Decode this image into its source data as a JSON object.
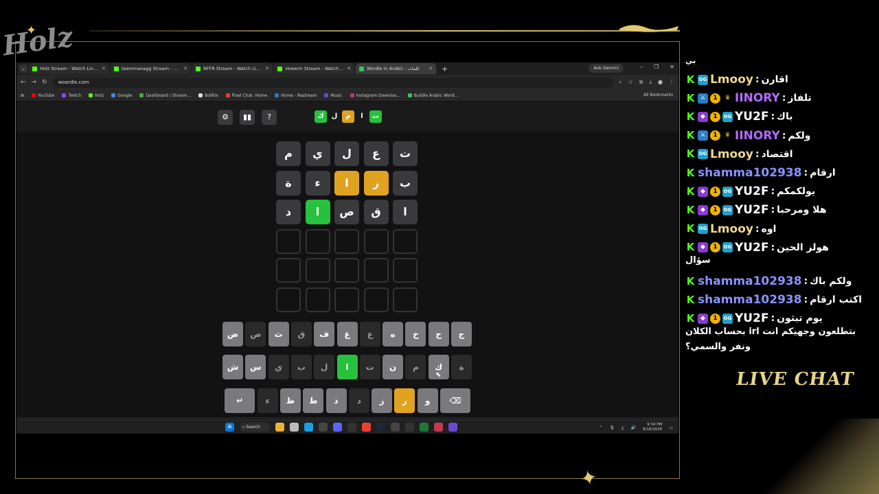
{
  "overlay": {
    "logo_text": "Holz",
    "live_chat_label": "LIVE CHAT"
  },
  "browser": {
    "tabs": [
      {
        "title": "Holz Stream - Watch Live on Ki",
        "active": false
      },
      {
        "title": "teammanagg Stream - Kick Da",
        "active": false
      },
      {
        "title": "NFFR Stream - Watch Live on K",
        "active": false
      },
      {
        "title": "xkwerm Stream - Watch Live o",
        "active": false
      },
      {
        "title": "Wordle in Arabic - كلمات",
        "active": true
      }
    ],
    "ask_gemini": "Ask Gemini",
    "url": "woardle.com",
    "bookmarks": [
      "YouTube",
      "Twitch",
      "Holz",
      "Google",
      "Dashboard / Stream...",
      "BotRix",
      "Pixel Chat: Home",
      "Home - Restream",
      "Music",
      "Instagram Downloa...",
      "Buildle Arabic Word..."
    ],
    "all_bookmarks": "All Bookmarks"
  },
  "game": {
    "logo_tiles": [
      {
        "ch": "ك",
        "state": "correct"
      },
      {
        "ch": "ل",
        "state": "plain"
      },
      {
        "ch": "م",
        "state": "present"
      },
      {
        "ch": "ا",
        "state": "plain"
      },
      {
        "ch": "ت",
        "state": "correct"
      }
    ],
    "rows": [
      [
        {
          "ch": "ت",
          "s": "a"
        },
        {
          "ch": "ع",
          "s": "a"
        },
        {
          "ch": "ل",
          "s": "a"
        },
        {
          "ch": "ي",
          "s": "a"
        },
        {
          "ch": "م",
          "s": "a"
        }
      ],
      [
        {
          "ch": "ب",
          "s": "a"
        },
        {
          "ch": "ر",
          "s": "p"
        },
        {
          "ch": "ا",
          "s": "p"
        },
        {
          "ch": "ء",
          "s": "a"
        },
        {
          "ch": "ة",
          "s": "a"
        }
      ],
      [
        {
          "ch": "ا",
          "s": "a"
        },
        {
          "ch": "ق",
          "s": "a"
        },
        {
          "ch": "ص",
          "s": "a"
        },
        {
          "ch": "ا",
          "s": "c"
        },
        {
          "ch": "د",
          "s": "a"
        }
      ],
      [
        {
          "ch": "",
          "s": "e"
        },
        {
          "ch": "",
          "s": "e"
        },
        {
          "ch": "",
          "s": "e"
        },
        {
          "ch": "",
          "s": "e"
        },
        {
          "ch": "",
          "s": "e"
        }
      ],
      [
        {
          "ch": "",
          "s": "e"
        },
        {
          "ch": "",
          "s": "e"
        },
        {
          "ch": "",
          "s": "e"
        },
        {
          "ch": "",
          "s": "e"
        },
        {
          "ch": "",
          "s": "e"
        }
      ],
      [
        {
          "ch": "",
          "s": "e"
        },
        {
          "ch": "",
          "s": "e"
        },
        {
          "ch": "",
          "s": "e"
        },
        {
          "ch": "",
          "s": "e"
        },
        {
          "ch": "",
          "s": "e"
        }
      ]
    ],
    "keyboard": [
      [
        {
          "k": "ج",
          "s": "n"
        },
        {
          "k": "ح",
          "s": "n"
        },
        {
          "k": "خ",
          "s": "n"
        },
        {
          "k": "ه",
          "s": "n"
        },
        {
          "k": "ع",
          "s": "d"
        },
        {
          "k": "غ",
          "s": "n"
        },
        {
          "k": "ف",
          "s": "n"
        },
        {
          "k": "ق",
          "s": "d"
        },
        {
          "k": "ث",
          "s": "n"
        },
        {
          "k": "ص",
          "s": "d"
        },
        {
          "k": "ض",
          "s": "n"
        }
      ],
      [
        {
          "k": "ة",
          "s": "d"
        },
        {
          "k": "ك",
          "s": "n"
        },
        {
          "k": "م",
          "s": "d"
        },
        {
          "k": "ن",
          "s": "n"
        },
        {
          "k": "ت",
          "s": "d"
        },
        {
          "k": "ا",
          "s": "c"
        },
        {
          "k": "ل",
          "s": "d"
        },
        {
          "k": "ب",
          "s": "d"
        },
        {
          "k": "ي",
          "s": "d"
        },
        {
          "k": "س",
          "s": "n"
        },
        {
          "k": "ش",
          "s": "n"
        }
      ],
      [
        {
          "k": "⌫",
          "s": "n",
          "wide": true
        },
        {
          "k": "و",
          "s": "n"
        },
        {
          "k": "ر",
          "s": "p"
        },
        {
          "k": "ز",
          "s": "n"
        },
        {
          "k": "د",
          "s": "d"
        },
        {
          "k": "ذ",
          "s": "n"
        },
        {
          "k": "ط",
          "s": "n"
        },
        {
          "k": "ظ",
          "s": "n"
        },
        {
          "k": "ء",
          "s": "d"
        },
        {
          "k": "↵",
          "s": "n",
          "wide": true
        }
      ]
    ]
  },
  "taskbar": {
    "search": "Search",
    "time": "9:34 PM",
    "date": "8/16/2026",
    "lang": "ع"
  },
  "chat": [
    {
      "badges": [
        "k",
        "og"
      ],
      "user": "Lmooy",
      "color": "#f0d890",
      "msg": "اقارن"
    },
    {
      "badges": [
        "k",
        "mod",
        "one",
        "crown"
      ],
      "user": "IINORY",
      "color": "#b46bff",
      "msg": "تلفاز"
    },
    {
      "badges": [
        "k",
        "sub",
        "one",
        "og"
      ],
      "user": "YU2F",
      "color": "#ffffff",
      "msg": "باك"
    },
    {
      "badges": [
        "k",
        "mod",
        "one",
        "crown"
      ],
      "user": "IINORY",
      "color": "#b46bff",
      "msg": "ولكم"
    },
    {
      "badges": [
        "k",
        "og"
      ],
      "user": "Lmooy",
      "color": "#f0d890",
      "msg": "اقتصاد"
    },
    {
      "badges": [
        "k"
      ],
      "user": "shamma102938",
      "color": "#8a92ff",
      "msg": "ارقام"
    },
    {
      "badges": [
        "k",
        "sub",
        "one",
        "og"
      ],
      "user": "YU2F",
      "color": "#ffffff",
      "msg": "يولكمكم"
    },
    {
      "badges": [
        "k",
        "sub",
        "one",
        "og"
      ],
      "user": "YU2F",
      "color": "#ffffff",
      "msg": "هلا ومرحبا"
    },
    {
      "badges": [
        "k",
        "og"
      ],
      "user": "Lmooy",
      "color": "#f0d890",
      "msg": "اوه"
    },
    {
      "badges": [
        "k",
        "sub",
        "one",
        "og"
      ],
      "user": "YU2F",
      "color": "#ffffff",
      "msg": "هولز الحين",
      "cont": "سؤال"
    },
    {
      "badges": [
        "k"
      ],
      "user": "shamma102938",
      "color": "#8a92ff",
      "msg": "ولكم باك"
    },
    {
      "badges": [
        "k"
      ],
      "user": "shamma102938",
      "color": "#8a92ff",
      "msg": "اكتب ارقام"
    },
    {
      "badges": [
        "k",
        "sub",
        "one",
        "og"
      ],
      "user": "YU2F",
      "color": "#ffffff",
      "msg": "يوم تبثون",
      "cont": "بتطلعون وجهيكم انت irl بحساب الكلان",
      "cont2": "ونفر والسمي؟"
    }
  ]
}
